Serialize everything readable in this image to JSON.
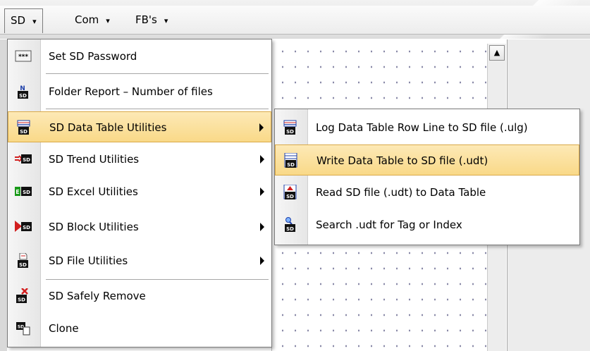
{
  "menubar": {
    "items": [
      {
        "label": "SD",
        "arrow": "▾"
      },
      {
        "label": "Com",
        "arrow": "▾"
      },
      {
        "label": "FB's",
        "arrow": "▾"
      }
    ]
  },
  "sd_menu": {
    "items": [
      {
        "label": "Set SD Password",
        "icon": "password-icon",
        "submenu": false
      },
      {
        "label": "Folder Report – Number of files",
        "icon": "folder-report-icon",
        "submenu": false
      },
      {
        "label": "SD Data Table Utilities",
        "icon": "data-table-icon",
        "submenu": true,
        "highlighted": true
      },
      {
        "label": "SD Trend Utilities",
        "icon": "trend-icon",
        "submenu": true
      },
      {
        "label": "SD Excel Utilities",
        "icon": "excel-icon",
        "submenu": true
      },
      {
        "label": "SD Block Utilities",
        "icon": "block-icon",
        "submenu": true
      },
      {
        "label": "SD File Utilities",
        "icon": "file-icon",
        "submenu": true
      },
      {
        "label": "SD Safely Remove",
        "icon": "safely-remove-icon",
        "submenu": false
      },
      {
        "label": "Clone",
        "icon": "clone-icon",
        "submenu": false
      }
    ]
  },
  "data_table_submenu": {
    "items": [
      {
        "label": "Log Data Table Row Line to SD file (.ulg)",
        "icon": "log-row-icon"
      },
      {
        "label": "Write Data Table to SD file (.udt)",
        "icon": "write-table-icon",
        "highlighted": true
      },
      {
        "label": "Read SD file (.udt) to Data Table",
        "icon": "read-table-icon"
      },
      {
        "label": "Search .udt for Tag or Index",
        "icon": "search-udt-icon"
      }
    ]
  },
  "icon_text": {
    "sd": "SD",
    "n": "N",
    "stars": "***"
  },
  "colors": {
    "highlight_top": "#fde9b6",
    "highlight_border": "#d9a948",
    "icon_blue": "#1d3fa8",
    "icon_red": "#d21f1f",
    "icon_green": "#1a9a1a"
  }
}
